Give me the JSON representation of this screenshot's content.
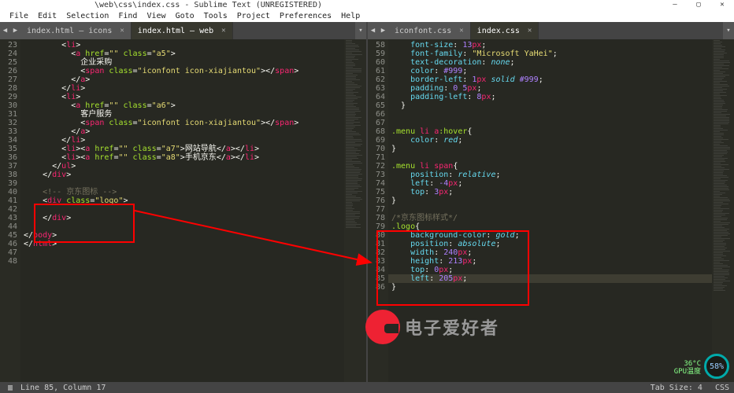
{
  "titlebar": {
    "path": "\\web\\css\\index.css - Sublime Text (UNREGISTERED)"
  },
  "win": {
    "min": "—",
    "max": "▢",
    "close": "✕"
  },
  "menu": [
    "File",
    "Edit",
    "Selection",
    "Find",
    "View",
    "Goto",
    "Tools",
    "Project",
    "Preferences",
    "Help"
  ],
  "left_tabs": [
    {
      "label": "index.html — icons",
      "active": false
    },
    {
      "label": "index.html — web",
      "active": true
    }
  ],
  "right_tabs": [
    {
      "label": "iconfont.css",
      "active": false
    },
    {
      "label": "index.css",
      "active": true
    }
  ],
  "left_pane": {
    "lines": [
      23,
      24,
      25,
      26,
      27,
      28,
      29,
      30,
      31,
      32,
      33,
      34,
      35,
      36,
      37,
      38,
      39,
      40,
      41,
      42,
      43,
      44,
      45,
      46,
      47,
      48
    ],
    "code_html": "        &lt;<span class='c-tag'>li</span>&gt;\n          &lt;<span class='c-tag'>a</span> <span class='c-attr'>href</span>=<span class='c-str'>&quot;&quot;</span> <span class='c-attr'>class</span>=<span class='c-str'>&quot;a5&quot;</span>&gt;\n            <span class='c-text'>企业采购</span>\n            &lt;<span class='c-tag'>span</span> <span class='c-attr'>class</span>=<span class='c-str'>&quot;iconfont icon-xiajiantou&quot;</span>&gt;&lt;/<span class='c-tag'>span</span>&gt;\n          &lt;/<span class='c-tag'>a</span>&gt;\n        &lt;/<span class='c-tag'>li</span>&gt;\n        &lt;<span class='c-tag'>li</span>&gt;\n          &lt;<span class='c-tag'>a</span> <span class='c-attr'>href</span>=<span class='c-str'>&quot;&quot;</span> <span class='c-attr'>class</span>=<span class='c-str'>&quot;a6&quot;</span>&gt;\n            <span class='c-text'>客户服务</span>\n            &lt;<span class='c-tag'>span</span> <span class='c-attr'>class</span>=<span class='c-str'>&quot;iconfont icon-xiajiantou&quot;</span>&gt;&lt;/<span class='c-tag'>span</span>&gt;\n          &lt;/<span class='c-tag'>a</span>&gt;\n        &lt;/<span class='c-tag'>li</span>&gt;\n        &lt;<span class='c-tag'>li</span>&gt;&lt;<span class='c-tag'>a</span> <span class='c-attr'>href</span>=<span class='c-str'>&quot;&quot;</span> <span class='c-attr'>class</span>=<span class='c-str'>&quot;a7&quot;</span>&gt;<span class='c-text'>网站导航</span>&lt;/<span class='c-tag'>a</span>&gt;&lt;/<span class='c-tag'>li</span>&gt;\n        &lt;<span class='c-tag'>li</span>&gt;&lt;<span class='c-tag'>a</span> <span class='c-attr'>href</span>=<span class='c-str'>&quot;&quot;</span> <span class='c-attr'>class</span>=<span class='c-str'>&quot;a8&quot;</span>&gt;<span class='c-text'>手机京东</span>&lt;/<span class='c-tag'>a</span>&gt;&lt;/<span class='c-tag'>li</span>&gt;\n      &lt;/<span class='c-tag'>ul</span>&gt;\n    &lt;/<span class='c-tag'>div</span>&gt;\n\n    <span class='c-comm'>&lt;!-- 京东图标 --&gt;</span>\n    &lt;<span class='c-tag'>div</span> <span class='c-attr'>class</span>=<span class='c-str'>&quot;logo&quot;</span>&gt;\n\n    &lt;/<span class='c-tag'>div</span>&gt;\n\n&lt;/<span class='c-tag'>body</span>&gt;\n&lt;/<span class='c-tag'>html</span>&gt;"
  },
  "right_pane": {
    "lines": [
      58,
      59,
      60,
      61,
      62,
      63,
      64,
      65,
      66,
      67,
      68,
      69,
      70,
      71,
      72,
      73,
      74,
      75,
      76,
      77,
      78,
      79,
      80,
      81,
      82,
      83,
      84,
      85,
      86
    ],
    "code_html": "    <span class='c-prop'>font-size</span>: <span class='c-val'>13</span><span class='c-tag'>px</span>;\n    <span class='c-prop'>font-family</span>: <span class='c-str'>&quot;Microsoft YaHei&quot;</span>;\n    <span class='c-prop'>text-decoration</span>: <span class='c-kw'>none</span>;\n    <span class='c-prop'>color</span>: <span class='c-hex'>#999</span>;\n    <span class='c-prop'>border-left</span>: <span class='c-val'>1</span><span class='c-tag'>px</span> <span class='c-kw'>solid</span> <span class='c-hex'>#999</span>;\n    <span class='c-prop'>padding</span>: <span class='c-val'>0</span> <span class='c-val'>5</span><span class='c-tag'>px</span>;\n    <span class='c-prop'>padding-left</span>: <span class='c-val'>8</span><span class='c-tag'>px</span>;\n  }\n\n\n<span class='c-sel'>.menu</span> <span class='c-tag'>li</span> <span class='c-tag'>a</span><span class='c-sel'>:hover</span>{\n    <span class='c-prop'>color</span>: <span class='c-kw'>red</span>;\n}\n\n<span class='c-sel'>.menu</span> <span class='c-tag'>li</span> <span class='c-tag'>span</span>{\n    <span class='c-prop'>position</span>: <span class='c-kw'>relative</span>;\n    <span class='c-prop'>left</span>: <span class='c-val'>-4</span><span class='c-tag'>px</span>;\n    <span class='c-prop'>top</span>: <span class='c-val'>3</span><span class='c-tag'>px</span>;\n}\n\n<span class='c-comm'>/*京东图标样式*/</span>\n<span class='c-sel'>.logo</span>{\n    <span class='c-prop'>background-color</span>: <span class='c-kw'>gold</span>;\n    <span class='c-prop'>position</span>: <span class='c-kw'>absolute</span>;\n    <span class='c-prop'>width</span>: <span class='c-val'>240</span><span class='c-tag'>px</span>;\n    <span class='c-prop'>height</span>: <span class='c-val'>213</span><span class='c-tag'>px</span>;\n    <span class='c-prop'>top</span>: <span class='c-val'>0</span><span class='c-tag'>px</span>;\n    <span class='c-prop'>left</span>: <span class='c-val'>205</span><span class='c-tag'>px</span>;\n}"
  },
  "watermark": {
    "text": "电子爱好者"
  },
  "status": {
    "left": "Line 85, Column 17",
    "right1": "Tab Size: 4",
    "right2": "CSS"
  },
  "gauge": {
    "pct": "58%",
    "temp1": "36°C",
    "temp2": "GPU温度"
  }
}
